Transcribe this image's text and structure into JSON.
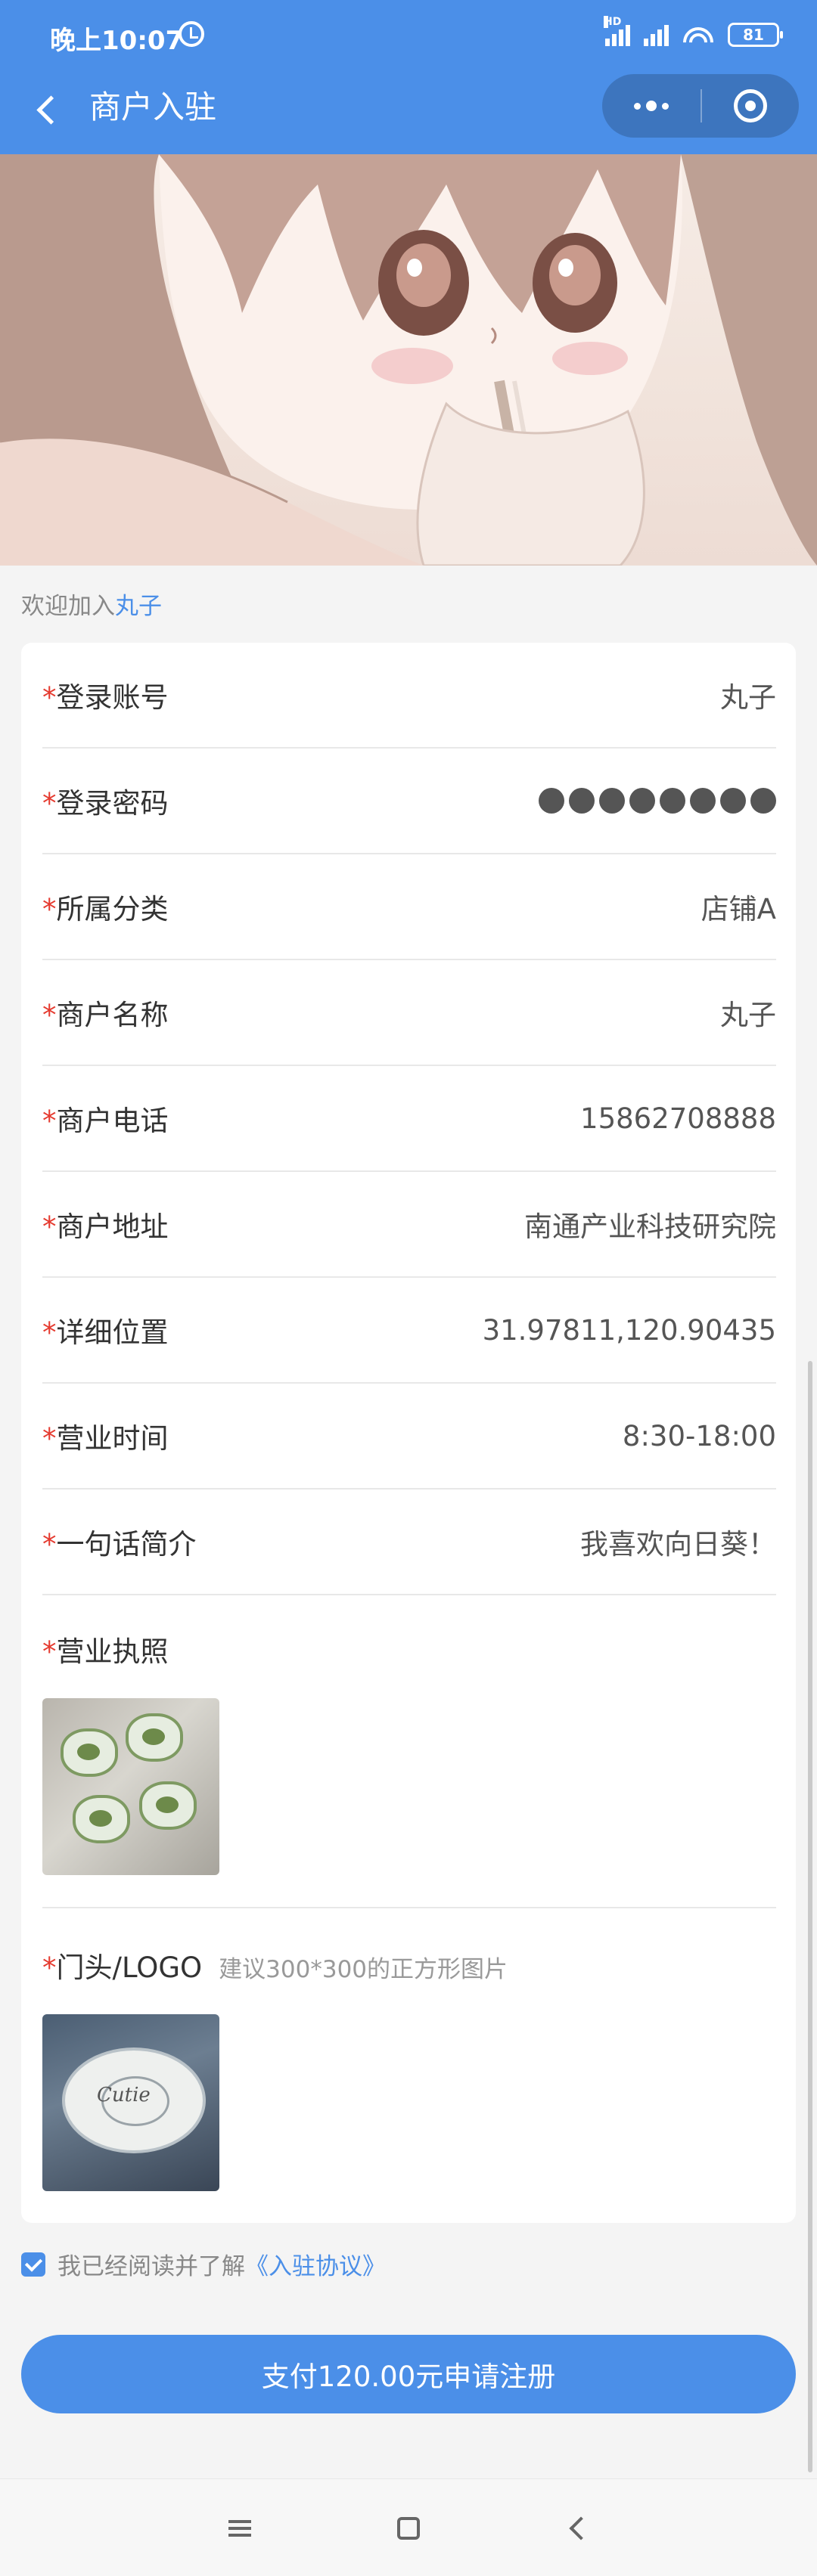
{
  "status_bar": {
    "time": "晚上10:07",
    "hd_label": "HD",
    "battery": "81"
  },
  "header": {
    "title": "商户入驻"
  },
  "welcome": {
    "prefix": "欢迎加入",
    "name": "丸子"
  },
  "form": {
    "required_mark": "*",
    "fields": [
      {
        "label": "登录账号",
        "value": "丸子"
      },
      {
        "label": "登录密码",
        "value": "",
        "masked": true,
        "mask_count": 8
      },
      {
        "label": "所属分类",
        "value": "店铺A"
      },
      {
        "label": "商户名称",
        "value": "丸子"
      },
      {
        "label": "商户电话",
        "value": "15862708888"
      },
      {
        "label": "商户地址",
        "value": "南通产业科技研究院"
      },
      {
        "label": "详细位置",
        "value": "31.97811,120.90435"
      },
      {
        "label": "营业时间",
        "value": "8:30-18:00"
      },
      {
        "label": "一句话简介",
        "value": "我喜欢向日葵！"
      }
    ],
    "license": {
      "label": "营业执照"
    },
    "logo": {
      "label": "门头/LOGO",
      "hint": "建议300*300的正方形图片",
      "image_text": "Cutie"
    }
  },
  "agreement": {
    "checked": true,
    "text": "我已经阅读并了解",
    "link": "《入驻协议》"
  },
  "submit": {
    "label": "支付120.00元申请注册"
  },
  "colors": {
    "primary": "#4b8fe8",
    "required": "#e53b30",
    "background": "#f4f4f4"
  },
  "icons": [
    "back-icon",
    "more-icon",
    "close-mini-program-icon",
    "checkbox-icon",
    "menu-icon",
    "home-icon",
    "back-system-icon"
  ]
}
